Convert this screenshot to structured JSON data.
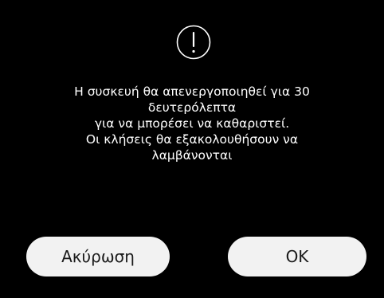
{
  "dialog": {
    "icon": "exclamation-circle-icon",
    "message_lines": [
      "Η συσκευή θα απενεργοποιηθεί για 30",
      "δευτερόλεπτα",
      "για να μπορέσει να καθαριστεί.",
      "Οι κλήσεις θα εξακολουθήσουν να",
      "λαμβάνονται"
    ],
    "cancel_label": "Ακύρωση",
    "ok_label": "OK"
  },
  "colors": {
    "background": "#000000",
    "text": "#ffffff",
    "button_background": "#f2f2f2",
    "button_text": "#1a1a1a"
  }
}
